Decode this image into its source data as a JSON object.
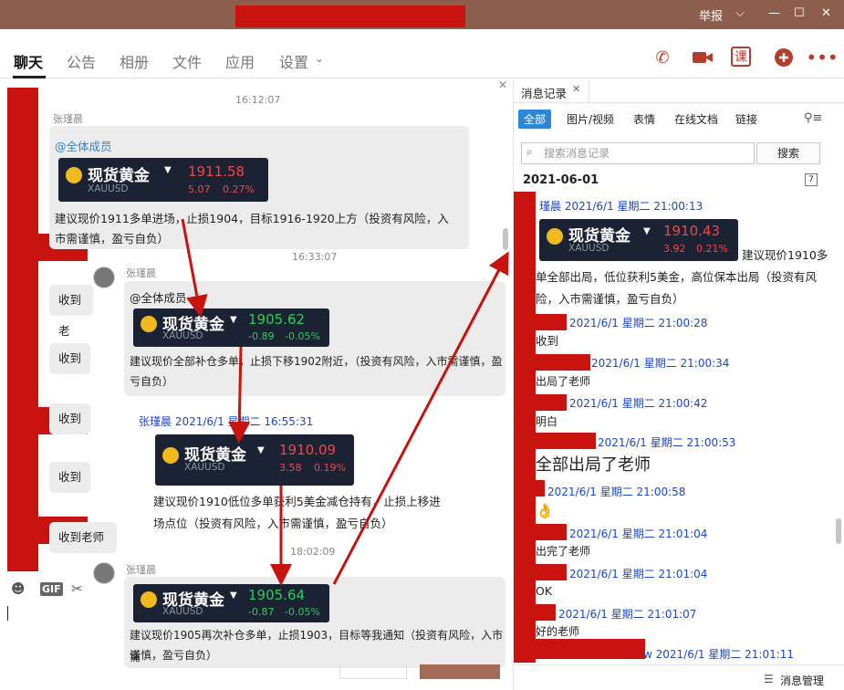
{
  "window": {
    "report_label": "举报"
  },
  "tabs": [
    "聊天",
    "公告",
    "相册",
    "文件",
    "应用",
    "设置"
  ],
  "top_icons": {
    "course_label": "课"
  },
  "chat": {
    "times": [
      "16:12:07",
      "16:33:07",
      "18:02:09"
    ],
    "sender": "张瑾晨",
    "mention": "@全体成员",
    "msg1": [
      "建议现价1911多单进场，止损1904，目标1916-1920上方（投资有风险，入",
      "市需谨慎，盈亏自负）"
    ],
    "msg2": [
      "建议现价全部补仓多单，止损下移1902附近，（投资有风险，入市需谨慎，盈",
      "亏自负）"
    ],
    "msg3_meta": "张瑾晨 2021/6/1 星期二 16:55:31",
    "msg3": [
      "建议现价1910低位多单获利5美金减仓持有，止损上移进",
      "场点位（投资有风险，入市需谨慎，盈亏自负）"
    ],
    "msg4": [
      "建议现价1905再次补仓多单，止损1903，目标等我通知（投资有风险，入市需",
      "谨慎，盈亏自负）"
    ],
    "left_replies": [
      "收到老",
      "收到",
      "收到",
      "收到",
      "收到老师"
    ],
    "cards": [
      {
        "name": "现货黄金",
        "symbol": "XAUUSD",
        "price": "1911.58",
        "change": "5.07",
        "pct": "0.27%",
        "dir": "up"
      },
      {
        "name": "现货黄金",
        "symbol": "XAUUSD",
        "price": "1905.62",
        "change": "-0.89",
        "pct": "-0.05%",
        "dir": "down"
      },
      {
        "name": "现货黄金",
        "symbol": "XAUUSD",
        "price": "1910.09",
        "change": "3.58",
        "pct": "0.19%",
        "dir": "up"
      },
      {
        "name": "现货黄金",
        "symbol": "XAUUSD",
        "price": "1905.64",
        "change": "-0.87",
        "pct": "-0.05%",
        "dir": "down"
      }
    ]
  },
  "history": {
    "title": "消息记录",
    "filters": [
      "全部",
      "图片/视频",
      "表情",
      "在线文档",
      "链接"
    ],
    "search_placeholder": "搜索消息记录",
    "search_button": "搜索",
    "date": "2021-06-01",
    "card": {
      "name": "现货黄金",
      "symbol": "XAUUSD",
      "price": "1910.43",
      "change": "3.92",
      "pct": "0.21%"
    },
    "entries": [
      {
        "meta": "瑾晨 2021/6/1 星期二 21:00:13"
      },
      {
        "meta": "2021/6/1 星期二 21:00:28",
        "text": "收到"
      },
      {
        "meta": "2021/6/1 星期二 21:00:34",
        "text": "出局了老师"
      },
      {
        "meta": "2021/6/1 星期二 21:00:42",
        "text": "明白"
      },
      {
        "meta": "2021/6/1 星期二 21:00:53",
        "text": "全部出局了老师"
      },
      {
        "meta": "2021/6/1 星期二 21:00:58",
        "text": "👌"
      },
      {
        "meta": "2021/6/1 星期二 21:01:04",
        "text": "出完了老师"
      },
      {
        "meta": "2021/6/1 星期二 21:01:04",
        "text": "OK"
      },
      {
        "meta": "2021/6/1 星期二 21:01:07",
        "text": "好的老师"
      },
      {
        "meta": "w 2021/6/1 星期二 21:01:11"
      }
    ],
    "card_msg": [
      "建议现价1910多",
      "单全部出局，低位获利5美金，高位保本出局（投资有风",
      "险，入市需谨慎，盈亏自负）"
    ],
    "manage_label": "消息管理"
  },
  "toolbar": {
    "gif_label": "GIF"
  }
}
